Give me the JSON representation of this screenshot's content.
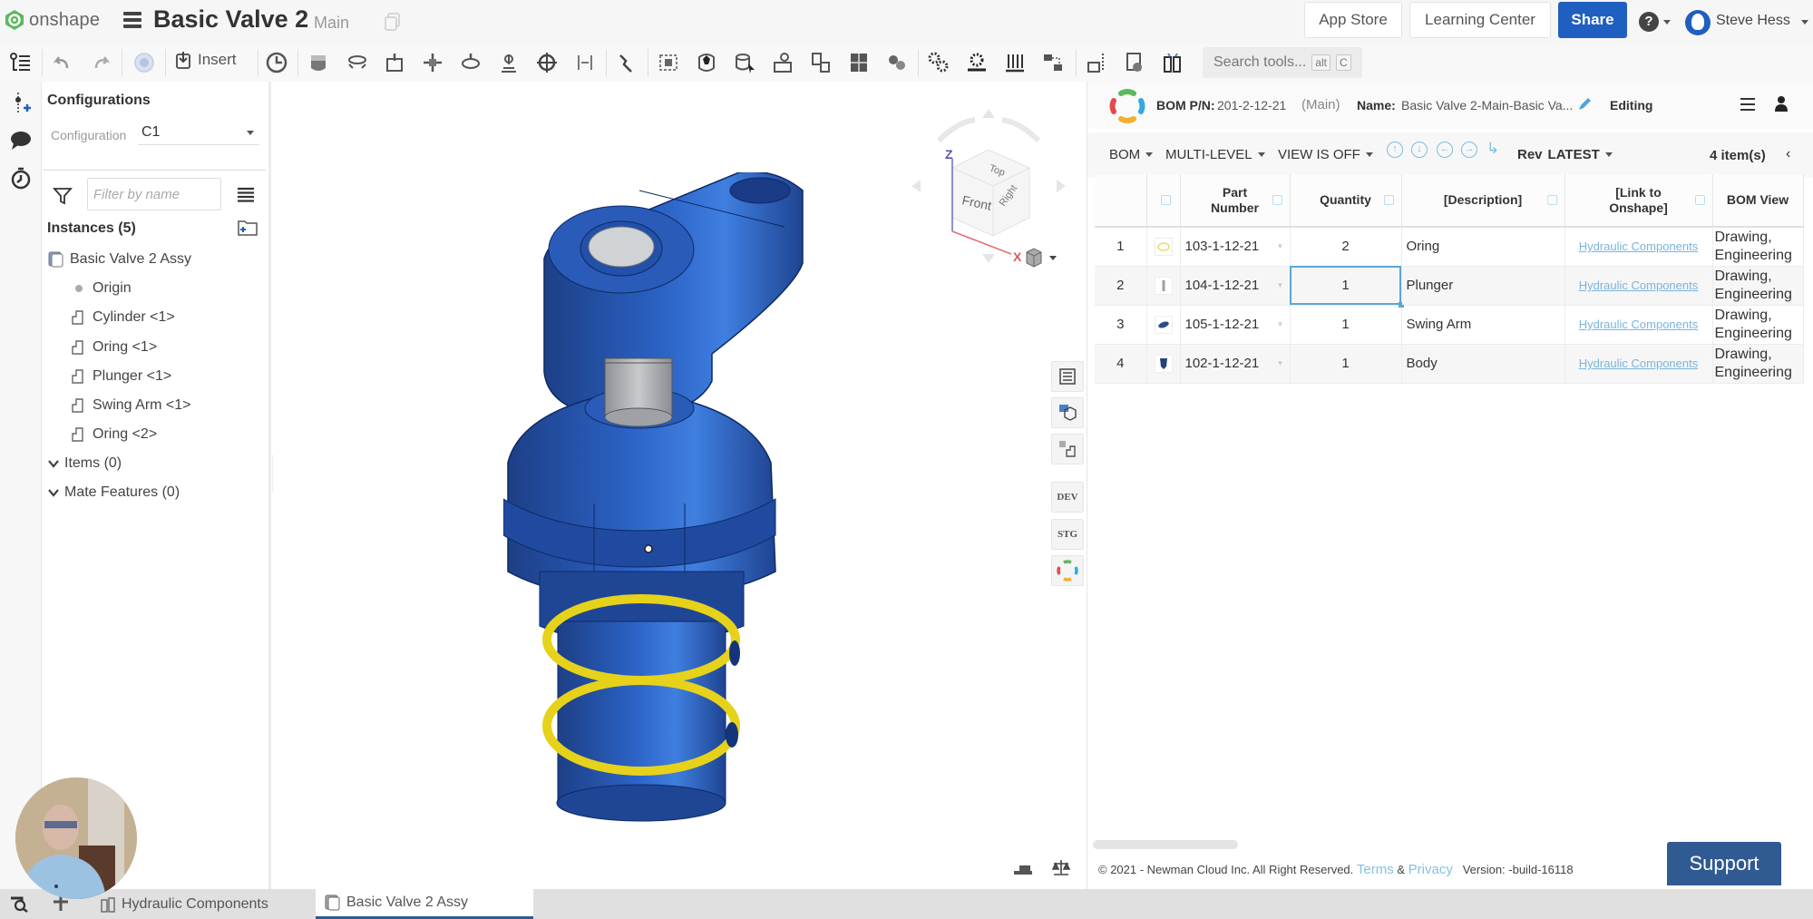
{
  "header": {
    "brand": "onshape",
    "document_title": "Basic Valve 2",
    "branch": "Main",
    "app_store_label": "App Store",
    "learning_center_label": "Learning Center",
    "share_label": "Share",
    "user_name": "Steve Hess",
    "brand_color": "#1f5fbf"
  },
  "toolbar": {
    "insert_label": "Insert",
    "search_placeholder": "Search tools...",
    "shortcut_keys": [
      "alt",
      "C"
    ]
  },
  "left_panel": {
    "configurations_title": "Configurations",
    "configuration_label": "Configuration",
    "configuration_value": "C1",
    "filter_placeholder": "Filter by name",
    "instances_title": "Instances (5)",
    "tree": [
      {
        "label": "Basic Valve 2 Assy",
        "type": "assembly"
      },
      {
        "label": "Origin",
        "type": "origin"
      },
      {
        "label": "Cylinder <1>",
        "type": "part"
      },
      {
        "label": "Oring <1>",
        "type": "part"
      },
      {
        "label": "Plunger <1>",
        "type": "part"
      },
      {
        "label": "Swing Arm <1>",
        "type": "part"
      },
      {
        "label": "Oring <2>",
        "type": "part"
      }
    ],
    "items_section": "Items (0)",
    "mate_features_section": "Mate Features (0)"
  },
  "viewport": {
    "viewcube_faces": [
      "Top",
      "Front",
      "Right"
    ],
    "axes": [
      "Z",
      "X"
    ],
    "side_buttons": [
      "DEV",
      "STG"
    ]
  },
  "bom": {
    "pn_label": "BOM P/N:",
    "pn_value": "201-2-12-21",
    "branch": "(Main)",
    "name_label": "Name:",
    "name_value": "Basic Valve 2-Main-Basic Va...",
    "status": "Editing",
    "toolbar": {
      "bom_menu": "BOM",
      "level_menu": "MULTI-LEVEL",
      "view_menu": "VIEW IS OFF",
      "rev_label": "Rev",
      "rev_value": "LATEST",
      "items_count": "4 item(s)"
    },
    "columns": [
      "",
      "",
      "Part Number",
      "Quantity",
      "[Description]",
      "[Link to Onshape]",
      "BOM View"
    ],
    "rows": [
      {
        "index": "1",
        "part_number": "103-1-12-21",
        "quantity": "2",
        "description": "Oring",
        "link": "Hydraulic Components",
        "bom_view": [
          "Drawing,",
          "Engineering"
        ],
        "thumb_color": "#e8dc6a"
      },
      {
        "index": "2",
        "part_number": "104-1-12-21",
        "quantity": "1",
        "description": "Plunger",
        "link": "Hydraulic Components",
        "bom_view": [
          "Drawing,",
          "Engineering"
        ],
        "thumb_color": "#9aa0a6"
      },
      {
        "index": "3",
        "part_number": "105-1-12-21",
        "quantity": "1",
        "description": "Swing Arm",
        "link": "Hydraulic Components",
        "bom_view": [
          "Drawing,",
          "Engineering"
        ],
        "thumb_color": "#2d4d8c"
      },
      {
        "index": "4",
        "part_number": "102-1-12-21",
        "quantity": "1",
        "description": "Body",
        "link": "Hydraulic Components",
        "bom_view": [
          "Drawing,",
          "Engineering"
        ],
        "thumb_color": "#26407a"
      }
    ],
    "footer": {
      "copyright": "© 2021 - Newman Cloud Inc. All Right Reserved.",
      "terms": "Terms",
      "amp": "&",
      "privacy": "Privacy",
      "version": "Version: -build-16118"
    },
    "support_label": "Support"
  },
  "tabs": [
    {
      "label": "Hydraulic Components",
      "active": false
    },
    {
      "label": "Basic Valve 2 Assy",
      "active": true
    }
  ]
}
